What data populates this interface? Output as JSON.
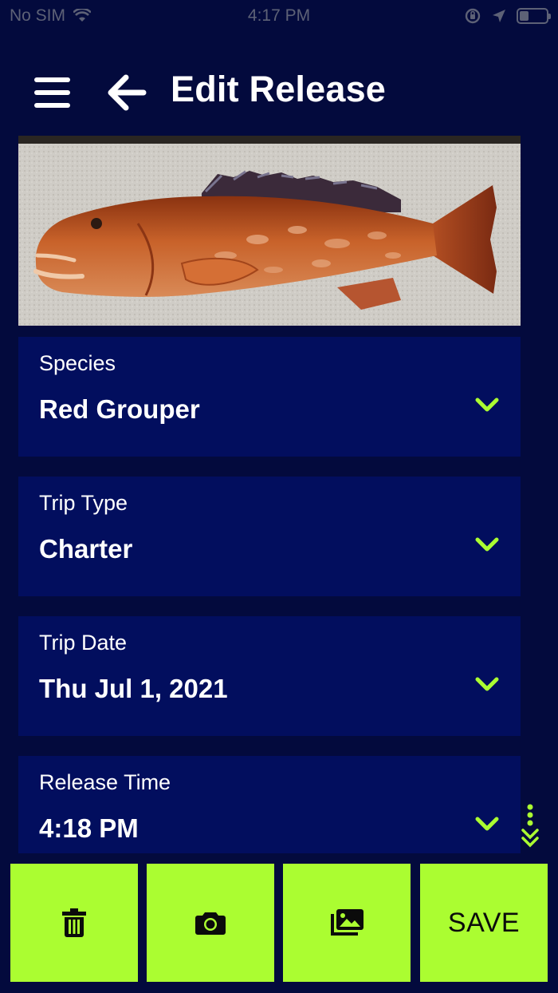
{
  "status_bar": {
    "carrier": "No SIM",
    "time": "4:17 PM",
    "battery_level": 0.35,
    "icons": [
      "wifi-icon",
      "orientation-lock-icon",
      "location-arrow-icon",
      "battery-icon"
    ]
  },
  "header": {
    "title": "Edit Release",
    "menu_icon": "hamburger-menu-icon",
    "back_icon": "arrow-left-icon"
  },
  "photo": {
    "subject": "red grouper fish photo"
  },
  "fields": [
    {
      "label": "Species",
      "value": "Red Grouper"
    },
    {
      "label": "Trip Type",
      "value": "Charter"
    },
    {
      "label": "Trip Date",
      "value": "Thu Jul 1, 2021"
    },
    {
      "label": "Release Time",
      "value": "4:18 PM"
    }
  ],
  "toolbar": {
    "delete_icon": "trash-icon",
    "camera_icon": "camera-icon",
    "gallery_icon": "photo-gallery-icon",
    "save_label": "SAVE"
  },
  "colors": {
    "background": "#030a3d",
    "field_background": "#020e5e",
    "accent": "#abfd31",
    "text": "#ffffff"
  }
}
